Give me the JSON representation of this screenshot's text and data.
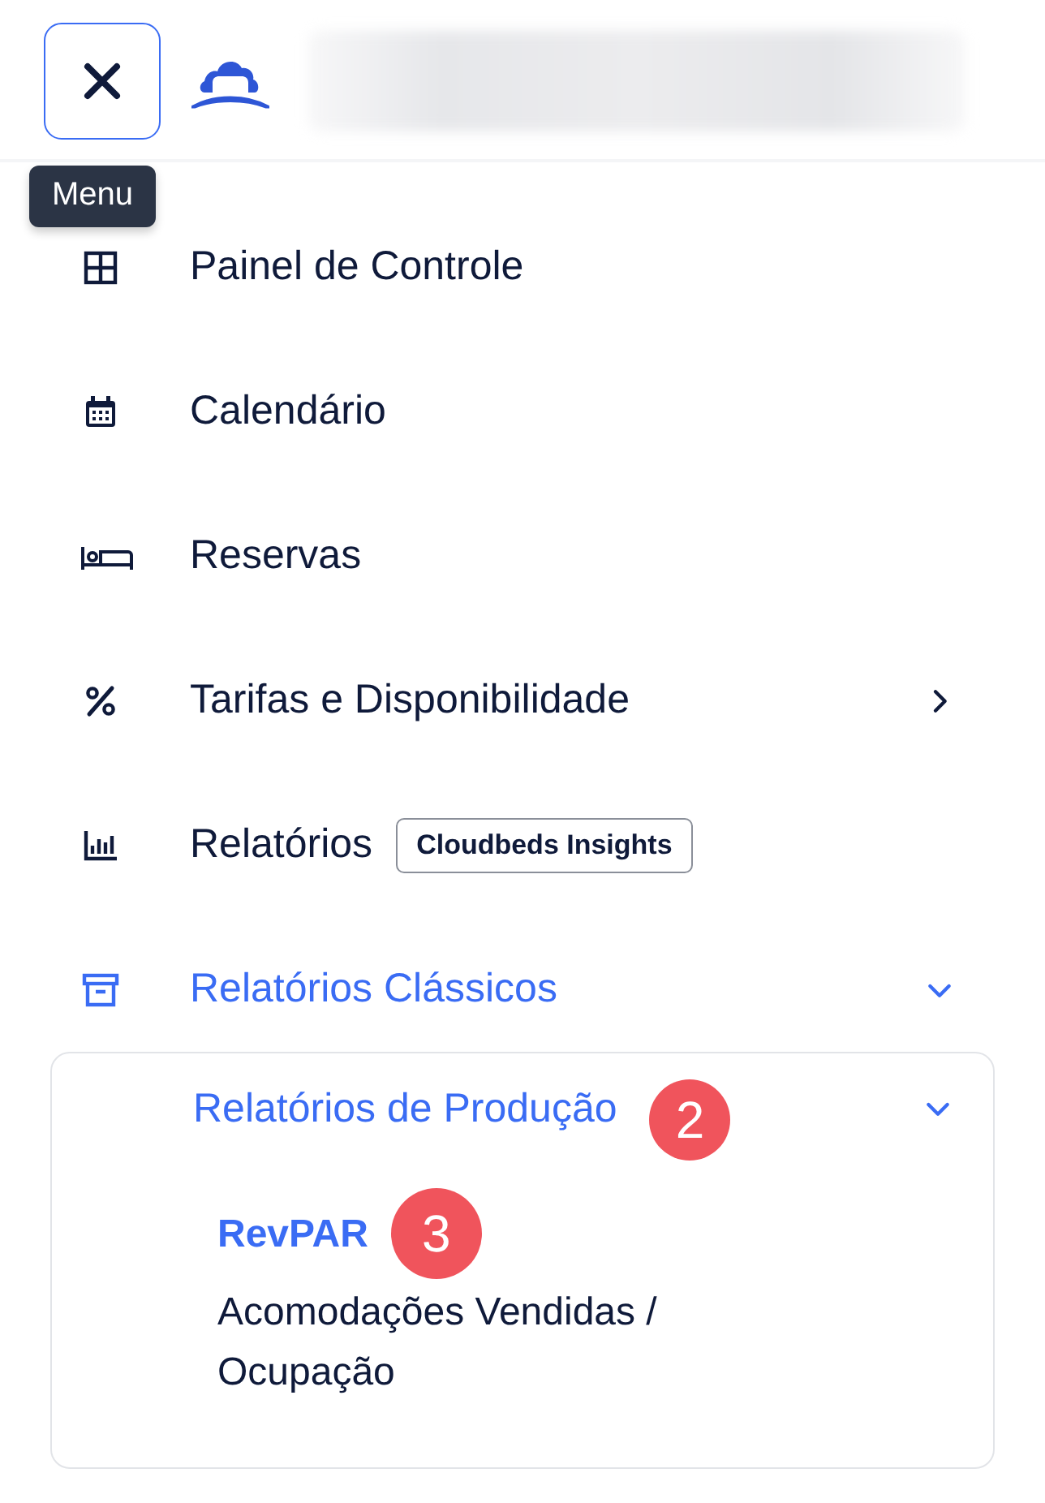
{
  "header": {
    "tooltip": "Menu"
  },
  "nav": [
    {
      "label": "Painel de Controle",
      "kind": "grid",
      "active": false
    },
    {
      "label": "Calendário",
      "kind": "calendar",
      "active": false
    },
    {
      "label": "Reservas",
      "kind": "bed",
      "active": false
    },
    {
      "label": "Tarifas e Disponibilidade",
      "kind": "percent",
      "active": false,
      "expanded": false
    },
    {
      "label": "Relatórios",
      "kind": "chart",
      "active": false,
      "tag": "Cloudbeds Insights"
    },
    {
      "label": "Relatórios Clássicos",
      "kind": "archive",
      "active": true,
      "expanded": true
    }
  ],
  "submenu": {
    "label": "Relatórios de Produção",
    "badge": "2",
    "active": true,
    "expanded": true,
    "children": [
      {
        "label": "RevPAR",
        "active": true,
        "badge": "3"
      },
      {
        "label": "Acomodações Vendidas / Ocupação",
        "active": false
      }
    ]
  }
}
